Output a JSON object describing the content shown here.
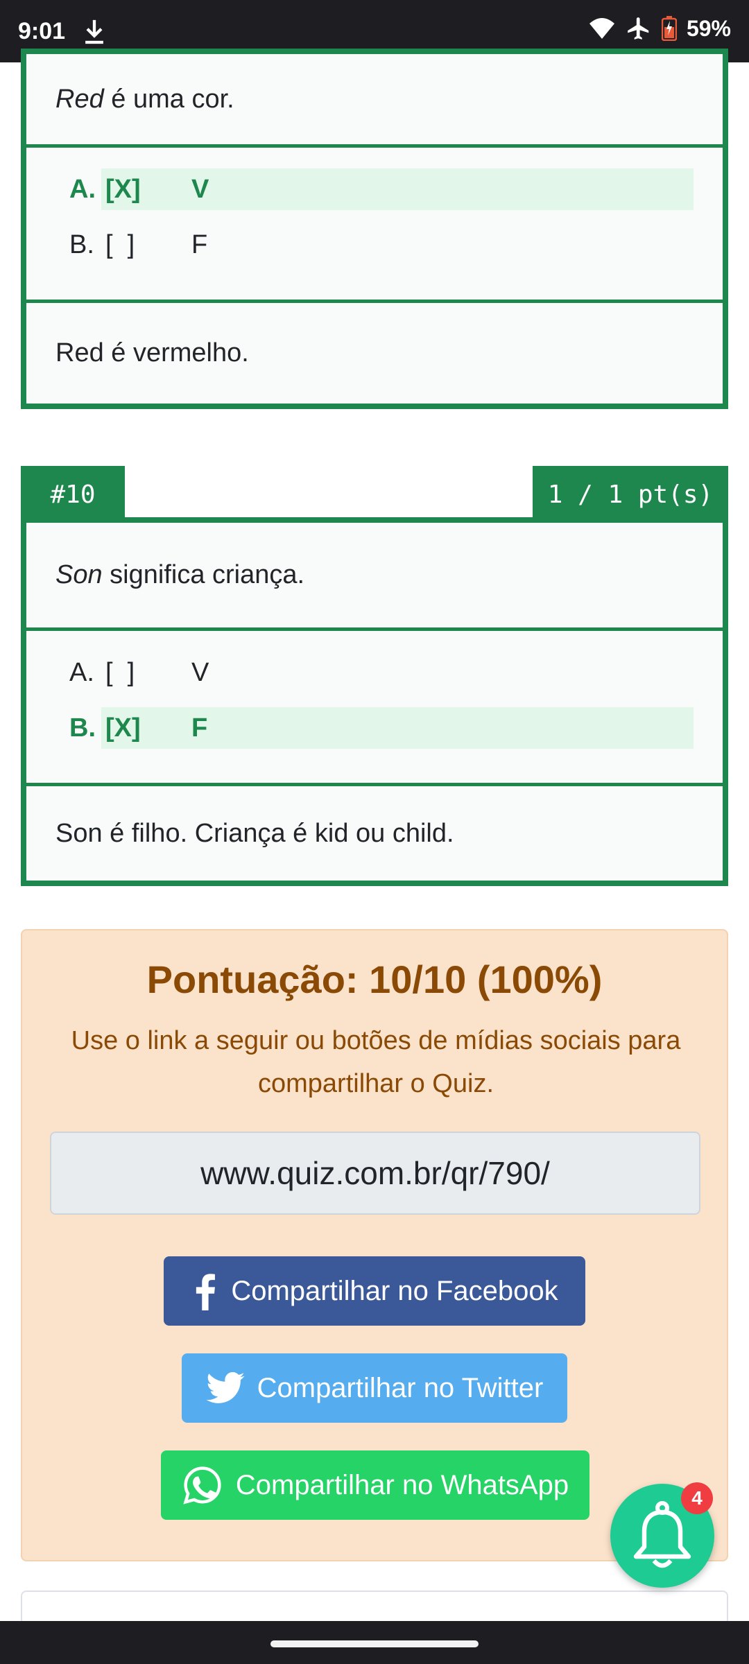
{
  "status": {
    "time": "9:01",
    "battery_pct": "59%"
  },
  "questions": [
    {
      "number": "",
      "points": "",
      "prefix_em": "Red",
      "prefix_rest": " é uma cor.",
      "options": [
        {
          "letter": "A.",
          "box": "[X]",
          "value": "V",
          "selected": true
        },
        {
          "letter": "B.",
          "box": "[  ]",
          "value": "F",
          "selected": false
        }
      ],
      "explanation": "Red é vermelho."
    },
    {
      "number": "#10",
      "points": "1 / 1 pt(s)",
      "prefix_em": "Son",
      "prefix_rest": " significa criança.",
      "options": [
        {
          "letter": "A.",
          "box": "[  ]",
          "value": "V",
          "selected": false
        },
        {
          "letter": "B.",
          "box": "[X]",
          "value": "F",
          "selected": true
        }
      ],
      "explanation": "Son é filho. Criança é kid ou child."
    }
  ],
  "result": {
    "title": "Pontuação: 10/10 (100%)",
    "text": "Use o link a seguir ou botões de mídias sociais para compartilhar o Quiz.",
    "link": "www.quiz.com.br/qr/790/",
    "facebook_label": "Compartilhar no Facebook",
    "twitter_label": "Compartilhar no Twitter",
    "whatsapp_label": "Compartilhar no WhatsApp"
  },
  "notifications": {
    "count": "4"
  },
  "colors": {
    "correct_green": "#1e874d",
    "correct_bg": "#e2f7ea",
    "result_bg": "#fbe3cb",
    "result_text": "#8a4a06",
    "facebook": "#3b5998",
    "twitter": "#55acee",
    "whatsapp": "#25d366",
    "bell": "#1ecc93",
    "badge": "#ef3d42"
  }
}
